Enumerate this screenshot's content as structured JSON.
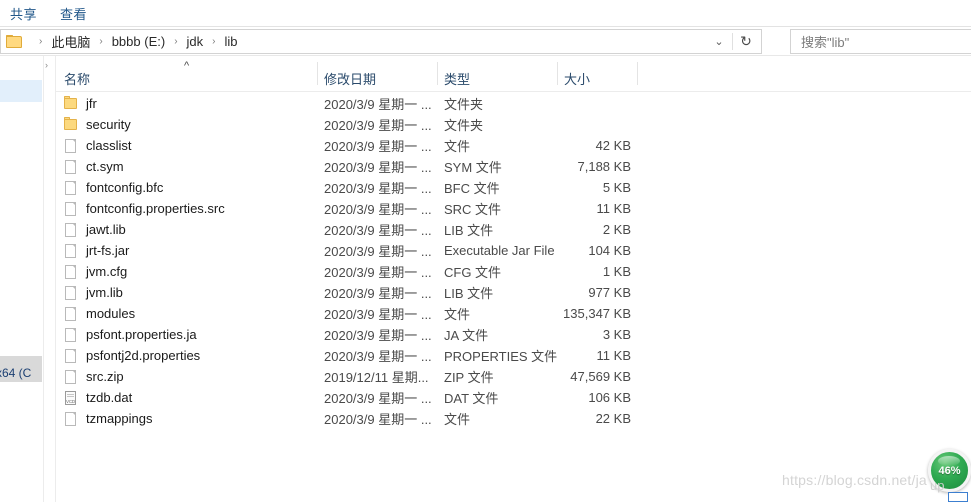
{
  "ribbon": {
    "tabs": [
      {
        "label": "共享"
      },
      {
        "label": "查看"
      }
    ]
  },
  "address_bar": {
    "folder_icon": "folder-icon",
    "breadcrumbs": [
      {
        "label": "此电脑"
      },
      {
        "label": "bbbb (E:)"
      },
      {
        "label": "jdk"
      },
      {
        "label": "lib"
      }
    ],
    "separator": "›",
    "dropdown_icon": "chevron-down-icon",
    "refresh_icon": "refresh-icon",
    "refresh_glyph": "↻",
    "chevron_glyph": "⌄"
  },
  "search": {
    "placeholder": "搜索\"lib\"",
    "value": "搜索\"lib\""
  },
  "background_window": {
    "partial_text": "x64 (C"
  },
  "nav_pane": {
    "expand_glyph": "›"
  },
  "columns": {
    "name": "名称",
    "date_modified": "修改日期",
    "type": "类型",
    "size": "大小",
    "sort_caret": "^",
    "sort_column": "名称",
    "sort_direction": "asc"
  },
  "files": [
    {
      "name": "jfr",
      "icon": "folder-icon",
      "date": "2020/3/9 星期一 ...",
      "type": "文件夹",
      "size": ""
    },
    {
      "name": "security",
      "icon": "folder-icon",
      "date": "2020/3/9 星期一 ...",
      "type": "文件夹",
      "size": ""
    },
    {
      "name": "classlist",
      "icon": "file-icon",
      "date": "2020/3/9 星期一 ...",
      "type": "文件",
      "size": "42 KB"
    },
    {
      "name": "ct.sym",
      "icon": "file-icon",
      "date": "2020/3/9 星期一 ...",
      "type": "SYM 文件",
      "size": "7,188 KB"
    },
    {
      "name": "fontconfig.bfc",
      "icon": "file-icon",
      "date": "2020/3/9 星期一 ...",
      "type": "BFC 文件",
      "size": "5 KB"
    },
    {
      "name": "fontconfig.properties.src",
      "icon": "file-icon",
      "date": "2020/3/9 星期一 ...",
      "type": "SRC 文件",
      "size": "11 KB"
    },
    {
      "name": "jawt.lib",
      "icon": "file-icon",
      "date": "2020/3/9 星期一 ...",
      "type": "LIB 文件",
      "size": "2 KB"
    },
    {
      "name": "jrt-fs.jar",
      "icon": "file-icon",
      "date": "2020/3/9 星期一 ...",
      "type": "Executable Jar File",
      "size": "104 KB"
    },
    {
      "name": "jvm.cfg",
      "icon": "file-icon",
      "date": "2020/3/9 星期一 ...",
      "type": "CFG 文件",
      "size": "1 KB"
    },
    {
      "name": "jvm.lib",
      "icon": "file-icon",
      "date": "2020/3/9 星期一 ...",
      "type": "LIB 文件",
      "size": "977 KB"
    },
    {
      "name": "modules",
      "icon": "file-icon",
      "date": "2020/3/9 星期一 ...",
      "type": "文件",
      "size": "135,347 KB"
    },
    {
      "name": "psfont.properties.ja",
      "icon": "file-icon",
      "date": "2020/3/9 星期一 ...",
      "type": "JA 文件",
      "size": "3 KB"
    },
    {
      "name": "psfontj2d.properties",
      "icon": "file-icon",
      "date": "2020/3/9 星期一 ...",
      "type": "PROPERTIES 文件",
      "size": "11 KB"
    },
    {
      "name": "src.zip",
      "icon": "file-icon",
      "date": "2019/12/11 星期...",
      "type": "ZIP 文件",
      "size": "47,569 KB"
    },
    {
      "name": "tzdb.dat",
      "icon": "dat-file-icon",
      "date": "2020/3/9 星期一 ...",
      "type": "DAT 文件",
      "size": "106 KB"
    },
    {
      "name": "tzmappings",
      "icon": "file-icon",
      "date": "2020/3/9 星期一 ...",
      "type": "文件",
      "size": "22 KB"
    }
  ],
  "watermark": {
    "text": "https://blog.csdn.net/ja"
  },
  "progress_badge": {
    "percent": "46%",
    "sub_label": "up",
    "color": "#2faa52"
  }
}
